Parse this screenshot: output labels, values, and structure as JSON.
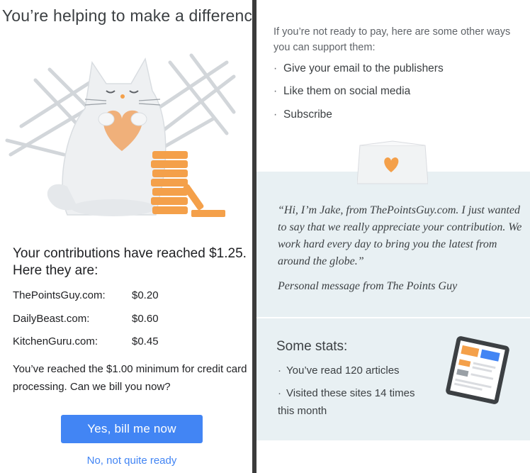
{
  "left": {
    "title": "You’re helping to make a difference",
    "reached": "Your contributions have reached $1.25. Here they are:",
    "contributions": [
      {
        "site": "ThePointsGuy.com:",
        "amount": "$0.20"
      },
      {
        "site": "DailyBeast.com:",
        "amount": "$0.60"
      },
      {
        "site": "KitchenGuru.com:",
        "amount": "$0.45"
      }
    ],
    "minimum_text": "You’ve reached the $1.00 minimum for credit card processing. Can we bill you now?",
    "bill_button": "Yes, bill me now",
    "not_ready_link": "No, not quite ready"
  },
  "right": {
    "support_intro": "If you’re not ready to pay, here are some other ways you can support them:",
    "options": [
      {
        "bullet": "·",
        "label": "Give your email to the publishers"
      },
      {
        "bullet": "·",
        "label": "Like them on social media"
      },
      {
        "bullet": "·",
        "label": "Subscribe"
      }
    ],
    "quote": "“Hi, I’m Jake, from ThePointsGuy.com. I just wanted to say that we really appreciate your contribution. We work hard every day to bring you the latest from around the globe.”",
    "quote_signature": "Personal message from The Points Guy",
    "stats_title": "Some stats:",
    "stats": [
      {
        "bullet": "·",
        "label": "You’ve read 120 articles"
      },
      {
        "bullet": "·",
        "label": "Visited these sites 14 times this month"
      }
    ]
  },
  "colors": {
    "accent_blue": "#4285f4",
    "coin_orange": "#f4a04a",
    "panel_bg": "#e8f0f3",
    "divider": "#3b3b3b"
  },
  "icons": [
    "cat-illustration",
    "heart-icon",
    "coins-illustration",
    "card-heart-icon",
    "tablet-illustration"
  ]
}
